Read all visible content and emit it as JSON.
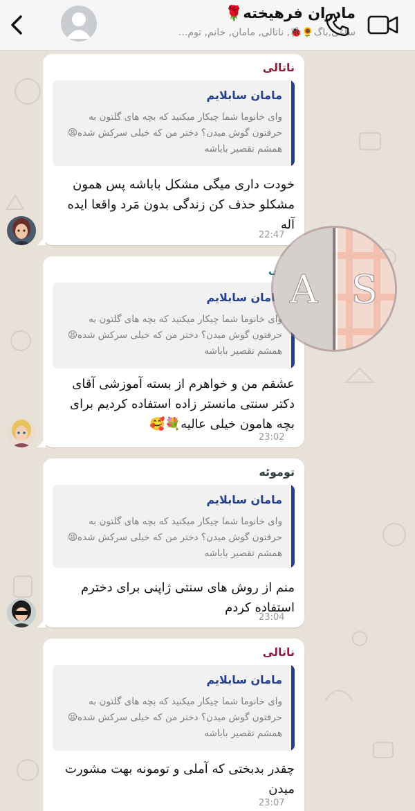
{
  "header": {
    "title": "مادران فرهیخته🌹",
    "members": "ساغی,باگ🌻🐞, ناتالی, مامان, خانم, توم..."
  },
  "watermark": {
    "letters": [
      "A",
      "S"
    ]
  },
  "quoted": {
    "name": "مامان سابلایم",
    "text": "وای خانوما شما چیکار میکنید که بچه های گلتون به حرفتون گوش میدن؟ دختر من که خیلی سرکش شده😫 همشم تقصیر باباشه"
  },
  "messages": [
    {
      "sender": "ناتالی",
      "sender_color": "#8e1e3c",
      "text": "خودت داری میگی مشکل باباشه پس همون مشکلو حذف کن زندگی بدون مَرد واقعا ایده آله",
      "time": "22:47"
    },
    {
      "sender": "آملی",
      "sender_color": "#1f6f8a",
      "text": "عشقم من و خواهرم از بسته آموزشی آقای دکتر سنتی مانستر زاده استفاده کردیم برای بچه هامون خیلی عالیه💐🥰",
      "time": "23:02"
    },
    {
      "sender": "توموئه",
      "sender_color": "#2c3e40",
      "text": "منم از روش های سنتی ژاپنی برای دخترم استفاده کردم",
      "time": "23:04"
    },
    {
      "sender": "ناتالی",
      "sender_color": "#8e1e3c",
      "text": "چقدر بدبختی که آملی و تومونه بهت مشورت میدن",
      "time": "23:07"
    }
  ]
}
